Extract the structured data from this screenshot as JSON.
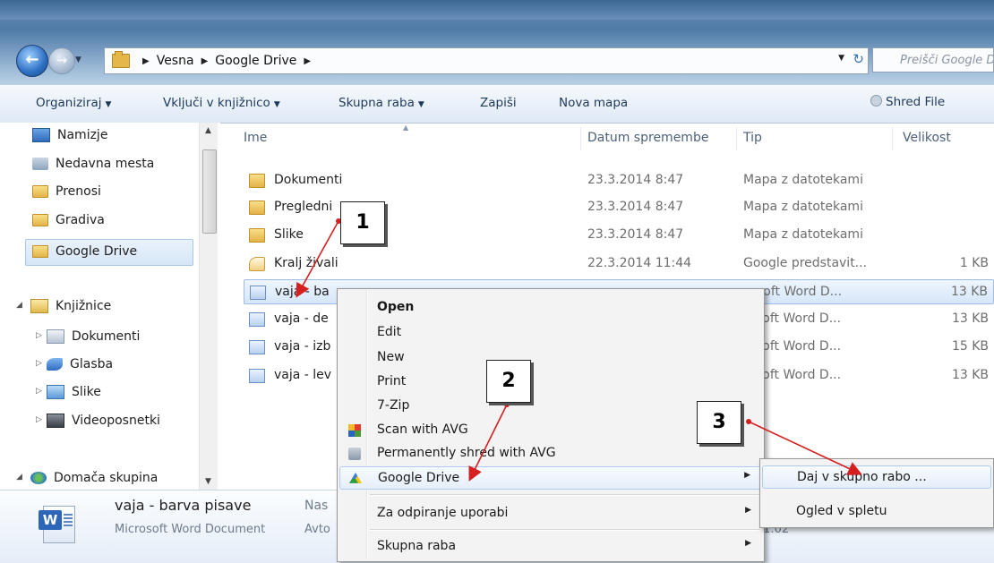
{
  "address": {
    "crumbs": [
      "Vesna",
      "Google Drive"
    ],
    "search_placeholder": "Preišči Google Drive"
  },
  "toolbar": {
    "organize": "Organiziraj",
    "include_library": "Vključi v knjižnico",
    "share": "Skupna raba",
    "burn": "Zapiši",
    "new_folder": "Nova mapa",
    "shred_file": "Shred File"
  },
  "nav": {
    "favorites": [
      "Namizje",
      "Nedavna mesta",
      "Prenosi",
      "Gradiva",
      "Google Drive"
    ],
    "libraries": "Knjižnice",
    "library_items": [
      "Dokumenti",
      "Glasba",
      "Slike",
      "Videoposnetki"
    ],
    "homegroup": "Domača skupina"
  },
  "columns": {
    "name": "Ime",
    "date": "Datum spremembe",
    "type": "Tip",
    "size": "Velikost"
  },
  "files": [
    {
      "name": "Dokumenti",
      "date": "23.3.2014 8:47",
      "type": "Mapa z datotekami",
      "size": ""
    },
    {
      "name": "Pregledni",
      "date": "23.3.2014 8:47",
      "type": "Mapa z datotekami",
      "size": ""
    },
    {
      "name": "Slike",
      "date": "23.3.2014 8:47",
      "type": "Mapa z datotekami",
      "size": ""
    },
    {
      "name": "Kralj živali",
      "date": "22.3.2014 11:44",
      "type": "Google predstavit...",
      "size": "1 KB"
    },
    {
      "name": "vaja - ba",
      "date": "",
      "type": "rosoft Word D...",
      "size": "13 KB"
    },
    {
      "name": "vaja - de",
      "date": "",
      "type": "rosoft Word D...",
      "size": "13 KB"
    },
    {
      "name": "vaja - izb",
      "date": "",
      "type": "rosoft Word D...",
      "size": "15 KB"
    },
    {
      "name": "vaja - lev",
      "date": "",
      "type": "rosoft Word D...",
      "size": "13 KB"
    }
  ],
  "context_menu": {
    "items": [
      "Open",
      "Edit",
      "New",
      "Print",
      "7-Zip",
      "Scan with AVG",
      "Permanently shred with AVG",
      "Google Drive",
      "Za odpiranje uporabi",
      "Skupna raba"
    ],
    "submenu": [
      "Daj v skupno rabo ...",
      "Ogled v spletu"
    ]
  },
  "details": {
    "name": "vaja - barva pisave",
    "type": "Microsoft Word Document",
    "tag1": "Nas",
    "tag2": "Avto",
    "date_fragment": "1:02"
  },
  "callouts": [
    "1",
    "2",
    "3"
  ],
  "colors": {
    "callout_arrow": "#d61f1f",
    "selection": "#d6e7fa"
  }
}
